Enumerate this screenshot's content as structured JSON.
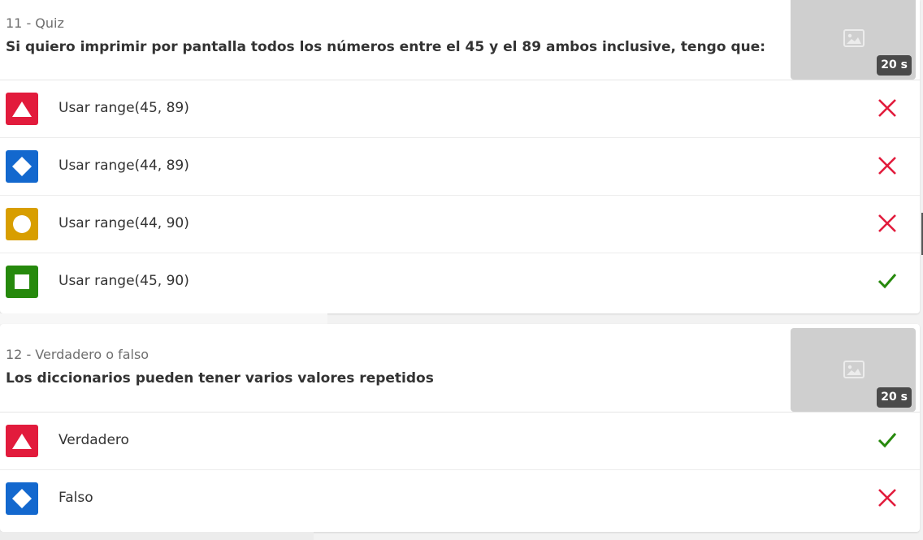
{
  "questions": [
    {
      "meta": "11 - Quiz",
      "title": "Si quiero imprimir por pantalla todos los números entre el 45 y el 89 ambos inclusive, tengo que:",
      "time": "20 s",
      "answers": [
        {
          "shape": "triangle",
          "color": "#e21b3c",
          "text": "Usar range(45, 89)",
          "correct": false
        },
        {
          "shape": "diamond",
          "color": "#1368ce",
          "text": "Usar range(44, 89)",
          "correct": false
        },
        {
          "shape": "circle",
          "color": "#d89e00",
          "text": "Usar range(44, 90)",
          "correct": false
        },
        {
          "shape": "square",
          "color": "#26890c",
          "text": "Usar range(45, 90)",
          "correct": true
        }
      ]
    },
    {
      "meta": "12 - Verdadero o falso",
      "title": "Los diccionarios pueden tener varios valores repetidos",
      "time": "20 s",
      "answers": [
        {
          "shape": "triangle",
          "color": "#e21b3c",
          "text": "Verdadero",
          "correct": true
        },
        {
          "shape": "diamond",
          "color": "#1368ce",
          "text": "Falso",
          "correct": false
        }
      ]
    }
  ],
  "icons": {
    "thumbnail": "image-placeholder-icon",
    "correct": "check-icon",
    "incorrect": "cross-icon"
  },
  "colors": {
    "correct": "#26890c",
    "incorrect": "#e21b3c",
    "thumbnail_bg": "#cfcfcf",
    "badge_bg": "#4a4a4a"
  }
}
